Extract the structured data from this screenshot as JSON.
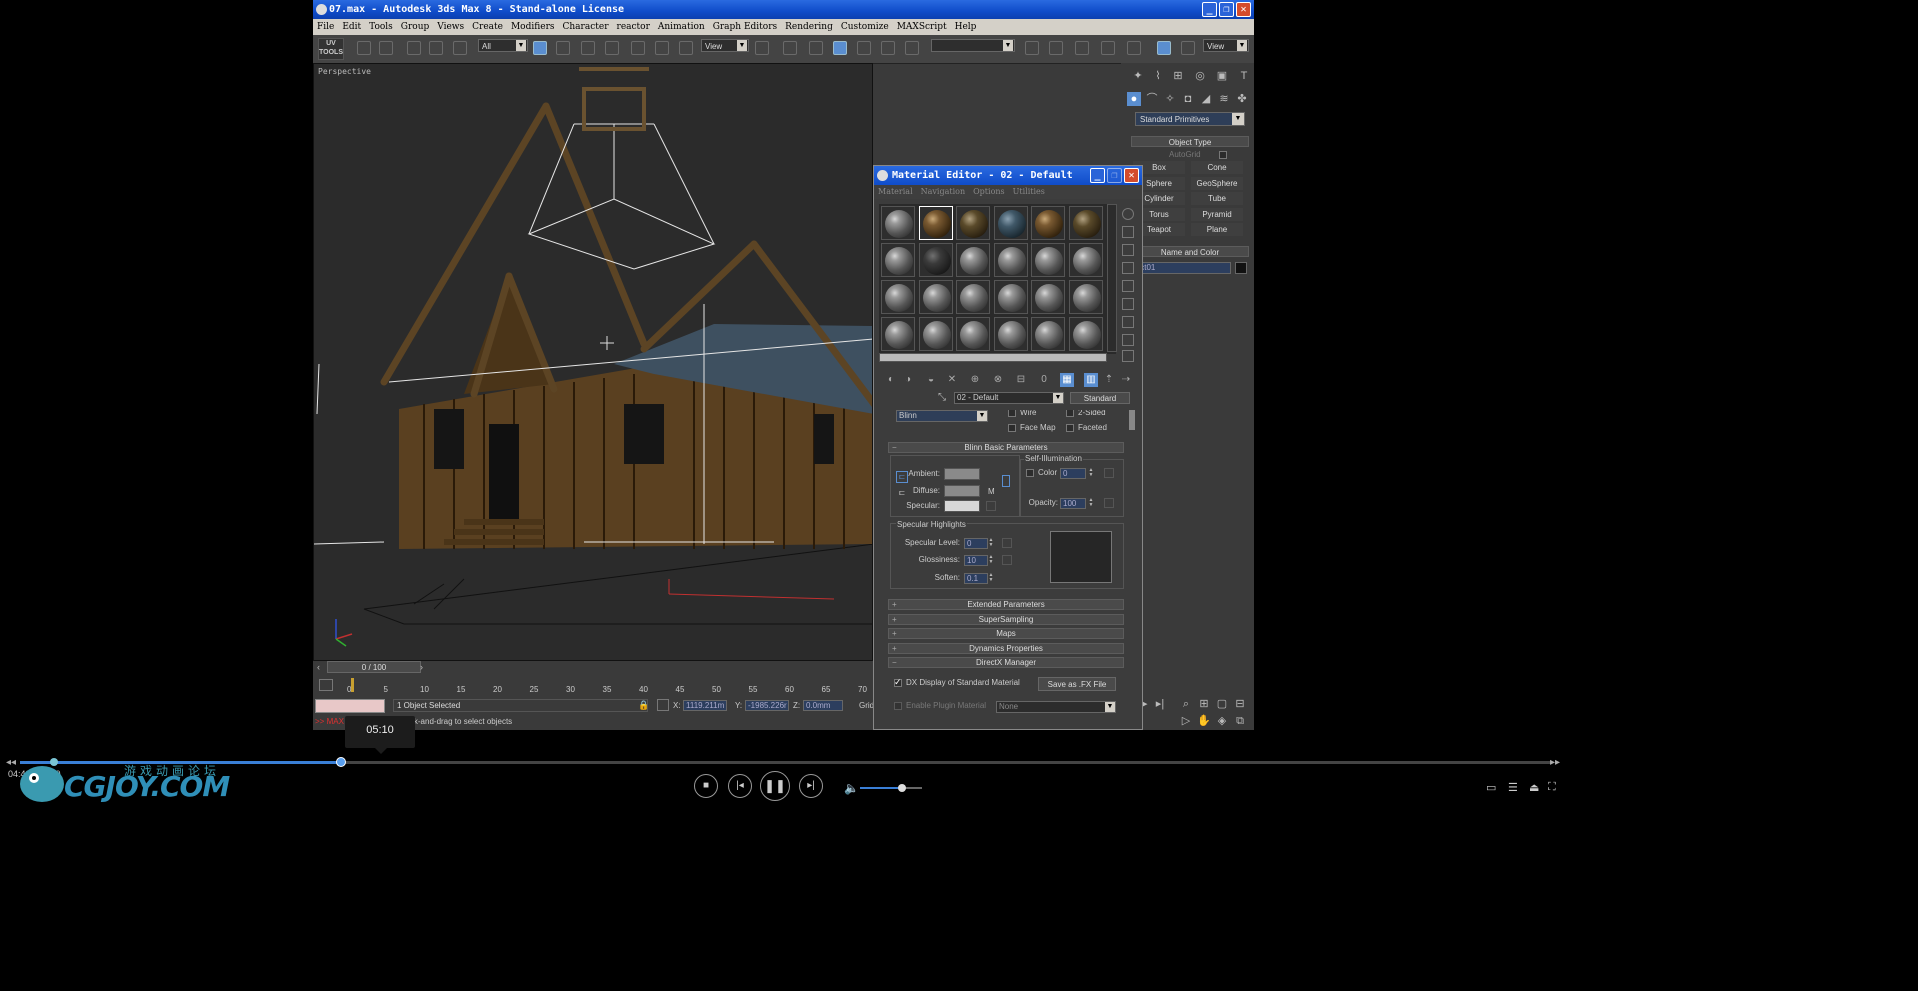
{
  "app": {
    "window_title": "07.max - Autodesk 3ds Max 8  - Stand-alone License",
    "menu": [
      "File",
      "Edit",
      "Tools",
      "Group",
      "Views",
      "Create",
      "Modifiers",
      "Character",
      "reactor",
      "Animation",
      "Graph Editors",
      "Rendering",
      "Customize",
      "MAXScript",
      "Help"
    ]
  },
  "toolbar": {
    "uv_tools": "UV TOOLS",
    "selection_filter": "All",
    "ref_coord": "View",
    "named_selection": "",
    "view_right": "View"
  },
  "viewport": {
    "label": "Perspective"
  },
  "command_panel": {
    "category": "Standard Primitives",
    "object_type_title": "Object Type",
    "autogrid": "AutoGrid",
    "buttons": [
      "Box",
      "Cone",
      "Sphere",
      "GeoSphere",
      "Cylinder",
      "Tube",
      "Torus",
      "Pyramid",
      "Teapot",
      "Plane"
    ],
    "name_color_title": "Name and Color",
    "object_name": "ject01"
  },
  "material_editor": {
    "title": "Material Editor - 02 - Default",
    "menu": [
      "Material",
      "Navigation",
      "Options",
      "Utilities"
    ],
    "material_name": "02 - Default",
    "material_type": "Standard",
    "shader": "Blinn",
    "wire": "Wire",
    "two_sided": "2-Sided",
    "face_map": "Face Map",
    "faceted": "Faceted",
    "blinn_title": "Blinn Basic Parameters",
    "self_illum_title": "Self-Illumination",
    "ambient": "Ambient:",
    "diffuse": "Diffuse:",
    "specular": "Specular:",
    "m_btn": "M",
    "color_label": "Color",
    "color_value": "0",
    "opacity_label": "Opacity:",
    "opacity_value": "100",
    "spec_hl_title": "Specular Highlights",
    "spec_level_label": "Specular Level:",
    "spec_level_value": "0",
    "glossiness_label": "Glossiness:",
    "glossiness_value": "10",
    "soften_label": "Soften:",
    "soften_value": "0.1",
    "rollouts": [
      "Extended Parameters",
      "SuperSampling",
      "Maps",
      "Dynamics Properties",
      "DirectX Manager"
    ],
    "dx_display": "DX Display of Standard Material",
    "save_fx": "Save as .FX File",
    "enable_plugin": "Enable Plugin Material",
    "plugin_value": "None"
  },
  "timeline": {
    "frame_display": "0 / 100",
    "ticks": [
      "0",
      "5",
      "10",
      "15",
      "20",
      "25",
      "30",
      "35",
      "40",
      "45",
      "50",
      "55",
      "60",
      "65",
      "70"
    ]
  },
  "status": {
    "selection": "1 Object Selected",
    "prompt_prefix": ">> MAX",
    "prompt": "or click-and-drag to select objects",
    "x_label": "X:",
    "x_value": "1119.211m",
    "y_label": "Y:",
    "y_value": "-1985.226r",
    "z_label": "Z:",
    "z_value": "0.0mm",
    "grid": "Grid"
  },
  "player": {
    "tooltip_time": "05:10",
    "elapsed": "04:42 / 22:10",
    "progress": 0.21,
    "volume": 0.68,
    "logo_main": "CGJOY.COM",
    "logo_sub": "游戏动画论坛"
  }
}
